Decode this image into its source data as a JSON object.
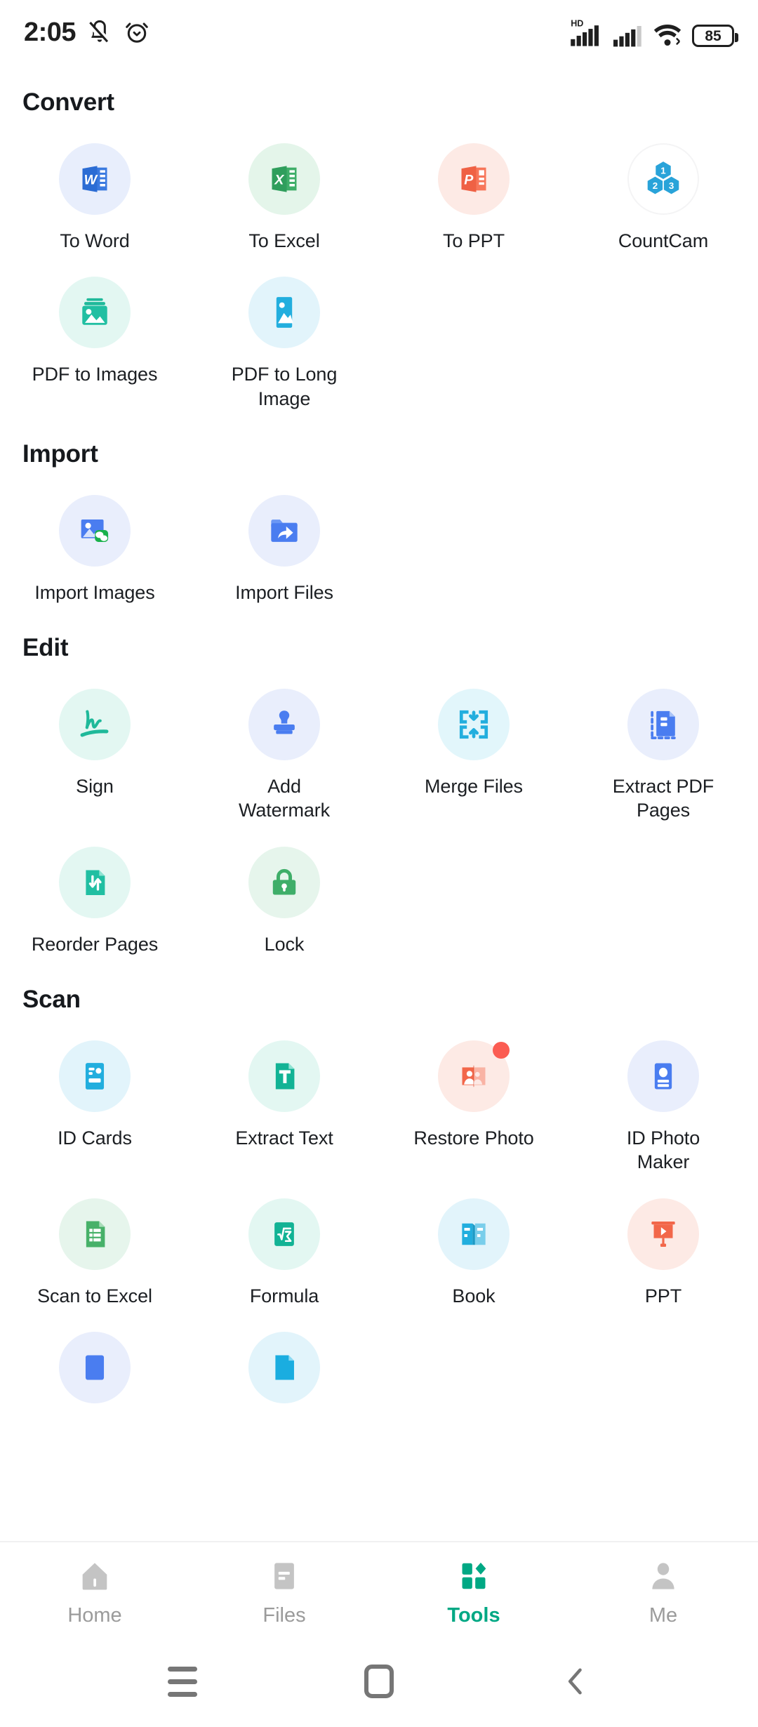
{
  "status_bar": {
    "time": "2:05",
    "left_icons": [
      "mute-icon",
      "alarm-icon"
    ],
    "network_label": "HD",
    "right_icons": [
      "hd-signal-icon",
      "signal-icon",
      "wifi-icon"
    ],
    "battery_percent": "85"
  },
  "sections": [
    {
      "title": "Convert",
      "items": [
        {
          "label": "To Word",
          "icon": "word-icon",
          "bg": "#e8eefc"
        },
        {
          "label": "To Excel",
          "icon": "excel-icon",
          "bg": "#e4f5ea"
        },
        {
          "label": "To PPT",
          "icon": "powerpoint-icon",
          "bg": "#fdeae5"
        },
        {
          "label": "CountCam",
          "icon": "countcam-hexagon-icon",
          "bg": "#ffffff"
        },
        {
          "label": "PDF to Images",
          "icon": "photo-stack-icon",
          "bg": "#e3f7f2"
        },
        {
          "label": "PDF to Long Image",
          "icon": "long-image-icon",
          "bg": "#e2f4fb"
        }
      ]
    },
    {
      "title": "Import",
      "items": [
        {
          "label": "Import Images",
          "icon": "image-wechat-icon",
          "bg": "#e9eefc"
        },
        {
          "label": "Import Files",
          "icon": "folder-import-icon",
          "bg": "#e9eefc"
        }
      ]
    },
    {
      "title": "Edit",
      "items": [
        {
          "label": "Sign",
          "icon": "signature-icon",
          "bg": "#e3f7f2"
        },
        {
          "label": "Add Watermark",
          "icon": "stamp-icon",
          "bg": "#e9eefc"
        },
        {
          "label": "Merge Files",
          "icon": "merge-icon",
          "bg": "#e2f6fb"
        },
        {
          "label": "Extract PDF Pages",
          "icon": "extract-pages-icon",
          "bg": "#e9eefc"
        },
        {
          "label": "Reorder Pages",
          "icon": "reorder-pages-icon",
          "bg": "#e3f7f2"
        },
        {
          "label": "Lock",
          "icon": "lock-icon",
          "bg": "#e6f5ec"
        }
      ]
    },
    {
      "title": "Scan",
      "items": [
        {
          "label": "ID Cards",
          "icon": "id-card-icon",
          "bg": "#e2f4fb"
        },
        {
          "label": "Extract Text",
          "icon": "text-file-icon",
          "bg": "#e3f7f2"
        },
        {
          "label": "Restore Photo",
          "icon": "restore-photo-icon",
          "bg": "#fdeae5",
          "badge": true
        },
        {
          "label": "ID Photo Maker",
          "icon": "id-photo-icon",
          "bg": "#e9eefc"
        },
        {
          "label": "Scan to Excel",
          "icon": "scan-excel-icon",
          "bg": "#e6f5ec"
        },
        {
          "label": "Formula",
          "icon": "formula-icon",
          "bg": "#e3f7f2"
        },
        {
          "label": "Book",
          "icon": "book-icon",
          "bg": "#e2f4fb"
        },
        {
          "label": "PPT",
          "icon": "ppt-board-icon",
          "bg": "#fdeae5"
        },
        {
          "label": "",
          "icon": "partial-blue-icon",
          "bg": "#e9eefc"
        },
        {
          "label": "",
          "icon": "partial-cyan-icon",
          "bg": "#e2f4fb"
        }
      ]
    }
  ],
  "tab_bar": {
    "tabs": [
      {
        "label": "Home",
        "icon": "home-icon",
        "active": false
      },
      {
        "label": "Files",
        "icon": "files-icon",
        "active": false
      },
      {
        "label": "Tools",
        "icon": "tools-icon",
        "active": true
      },
      {
        "label": "Me",
        "icon": "person-icon",
        "active": false
      }
    ],
    "active_color": "#00a884",
    "inactive_color": "#c4c4c4"
  },
  "system_nav": {
    "buttons": [
      "recents-menu-icon",
      "home-square-icon",
      "back-chevron-icon"
    ]
  }
}
